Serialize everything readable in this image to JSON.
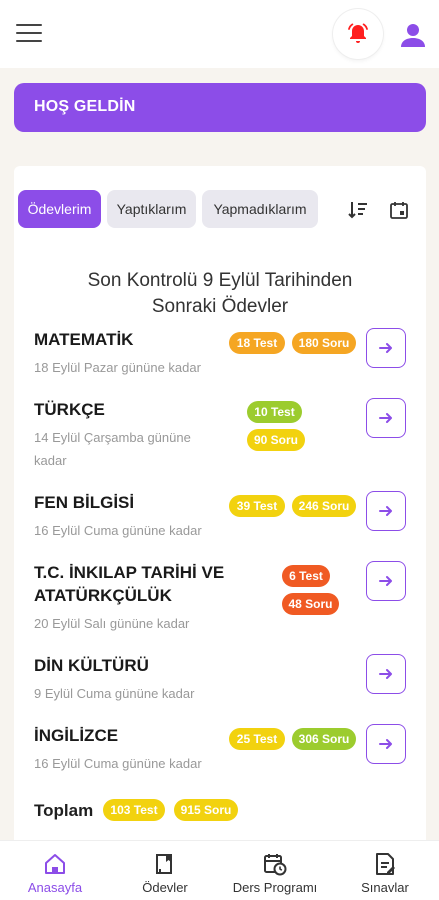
{
  "header": {
    "menu_icon": "hamburger-icon",
    "bell_icon": "bell-icon",
    "user_icon": "user-icon",
    "colors": {
      "bell": "#ff1f1f",
      "user": "#8c4de8"
    }
  },
  "welcome": {
    "text": "HOŞ GELDİN"
  },
  "tabs": [
    {
      "label": "Ödevlerim",
      "active": true
    },
    {
      "label": "Yaptıklarım",
      "active": false
    },
    {
      "label": "Yapmadıklarım",
      "active": false
    }
  ],
  "toolbar": {
    "sort_icon": "sort-icon",
    "calendar_icon": "calendar-icon"
  },
  "list": {
    "title_line1": "Son Kontrolü 9 Eylül Tarihinden",
    "title_line2": "Sonraki Ödevler",
    "items": [
      {
        "name": "MATEMATİK",
        "date": "18 Eylül Pazar gününe kadar",
        "tests": "18 Test",
        "questions": "180 Soru"
      },
      {
        "name": "TÜRKÇE",
        "date_line1": "14 Eylül Çarşamba gününe",
        "date_line2": "kadar",
        "tests": "10 Test",
        "questions": "90 Soru"
      },
      {
        "name": "FEN BİLGİSİ",
        "date": "16 Eylül Cuma gününe kadar",
        "tests": "39 Test",
        "questions": "246 Soru"
      },
      {
        "name_line1": "T.C. İNKILAP TARİHİ VE",
        "name_line2": "ATATÜRKÇÜLÜK",
        "date": "20 Eylül Salı gününe kadar",
        "tests": "6 Test",
        "questions": "48 Soru"
      },
      {
        "name": "DİN KÜLTÜRÜ",
        "date": "9 Eylül Cuma gününe kadar"
      },
      {
        "name": "İNGİLİZCE",
        "date": "16 Eylül Cuma gününe kadar",
        "tests": "25 Test",
        "questions": "306 Soru"
      }
    ],
    "total": {
      "label": "Toplam",
      "tests": "103 Test",
      "questions": "915 Soru"
    }
  },
  "bottom_nav": [
    {
      "label": "Anasayfa",
      "icon": "home-icon",
      "active": true
    },
    {
      "label": "Ödevler",
      "icon": "homework-icon",
      "active": false
    },
    {
      "label": "Ders Programı",
      "icon": "schedule-icon",
      "active": false
    },
    {
      "label": "Sınavlar",
      "icon": "exam-icon",
      "active": false
    }
  ],
  "colors": {
    "accent": "#8c4de8",
    "badge_orange": "#f5a623",
    "badge_green": "#9ccc2e",
    "badge_yellow": "#f2d20f",
    "badge_red": "#f05a23"
  }
}
